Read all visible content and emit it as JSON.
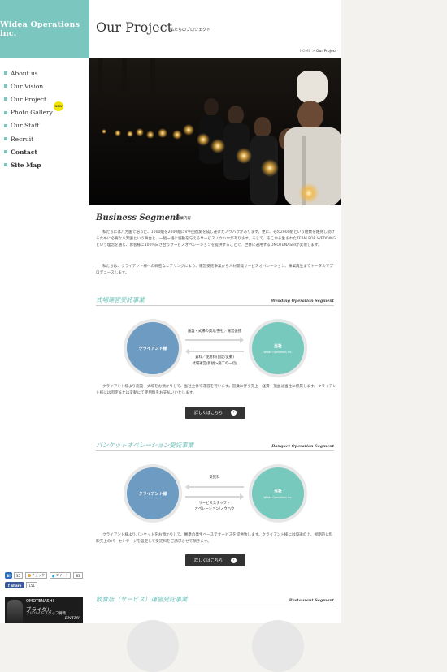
{
  "logo": "Widea Operations inc.",
  "nav": [
    {
      "label": "About us",
      "bold": false
    },
    {
      "label": "Our Vision",
      "bold": false
    },
    {
      "label": "Our Project",
      "bold": false
    },
    {
      "label": "Photo Gallery",
      "bold": false,
      "badge": "NEW"
    },
    {
      "label": "Our Staff",
      "bold": false
    },
    {
      "label": "Recruit",
      "bold": false
    },
    {
      "label": "Contact",
      "bold": true
    },
    {
      "label": "Site Map",
      "bold": true
    }
  ],
  "social": {
    "hatena": {
      "label": "B!",
      "count": "35"
    },
    "mixi": {
      "label": "チェック"
    },
    "twitter": {
      "label": "ツイート",
      "count": "83"
    },
    "facebook": {
      "label": "share",
      "count": "151"
    }
  },
  "banner": {
    "line1": "OMOTENASHI",
    "line2": "ブライダル",
    "line3": "アルバイトスタッフ募集",
    "line4": "ENTRY"
  },
  "header": {
    "title": "Our Project",
    "subtitle": "私たちのプロジェクト"
  },
  "breadcrumb": {
    "home": "HOME",
    "sep": ">",
    "current": "Our Project"
  },
  "business": {
    "title": "Business Segment",
    "subtitle": "事業内容",
    "para1": "私たちには八芳園で培った、1000組を2000組にV字回復劇を成し遂げたノウハウがあります。更に、その2000組という組数を維持し続けるために必要な八芳園という舞台と、一組一組に感動を与えるサービスノウハウがあります。そして、そこから生まれたTEAM FOR WEDDINGという理念を通じ、お客様に100%向き合うサービスオペレーションを提供することで、世界に通用するOMOTENASHIが実現します。",
    "para2": "私たちは、クライアント様への綿密なヒアリングにより、運営受託事業から人材開発サービスオペレーション、事業再生までトータルでプロデュースします。"
  },
  "segments": [
    {
      "title_jp": "式場運営受託事業",
      "title_en": "Wedding Operation Segment",
      "client": "クライアント様",
      "company": "当社",
      "company_en": "Widea Operations Inc.",
      "arrow_right": "施設・式場の貸与/整社／運営委託",
      "arrow_left_1": "賃料／使用料(固定/変動)",
      "arrow_left_2": "式場運営(新規〜施工の一切)",
      "desc": "クライアント様より施設・式場をお預かりして、当社主体で運営を行います。営業に伴う売上・経費・損益は当社に帰属します。クライアント様には固定または変動にて使用料をお支払いいたします。",
      "button": "詳しくはこちら"
    },
    {
      "title_jp": "バンケットオペレーション受託事業",
      "title_en": "Banquet Operation Segment",
      "client": "クライアント様",
      "company": "当社",
      "company_en": "Widea Operations Inc.",
      "arrow_left": "受託料",
      "arrow_right_1": "サービススタッフ・",
      "arrow_right_2": "オペレーション/ノウハウ",
      "desc": "クライアント様よりバンケットをお預かりして、審準の発生ベースでサービスを提供致します。クライアント様には協議の上、規期的に料飲売上のパーセンテージを設定して受託料をご請求させて頂きます。",
      "button": "詳しくはこちら"
    },
    {
      "title_jp": "飲食店（サービス）運営受託事業",
      "title_en": "Restaurant Segment"
    }
  ]
}
